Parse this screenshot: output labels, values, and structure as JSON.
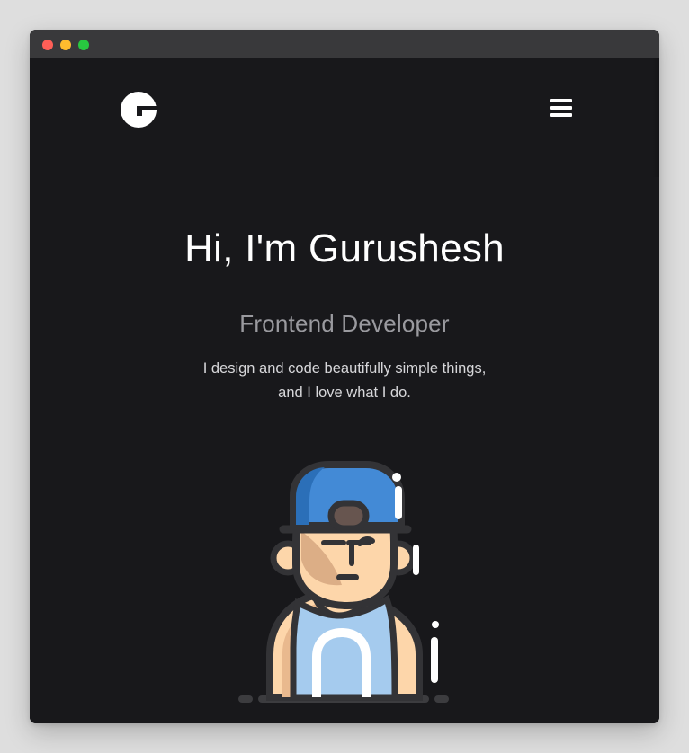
{
  "window": {
    "controls": [
      "close-icon",
      "minimize-icon",
      "maximize-icon"
    ]
  },
  "header": {
    "logo_icon": "g-logo-icon",
    "menu_icon": "hamburger-menu-icon"
  },
  "hero": {
    "title": "Hi, I'm Gurushesh",
    "subtitle": "Frontend Developer",
    "tagline_line1": "I design and code beautifully simple things,",
    "tagline_line2": "and I love what I do."
  },
  "colors": {
    "background": "#18181b",
    "titlebar": "#39393b",
    "text_primary": "#ffffff",
    "text_secondary": "#9a9a9f",
    "cap_blue": "#438ad6",
    "tank_top": "#a5cbee",
    "skin": "#fdd6aa"
  },
  "illustration": {
    "icon": "developer-avatar-icon"
  }
}
